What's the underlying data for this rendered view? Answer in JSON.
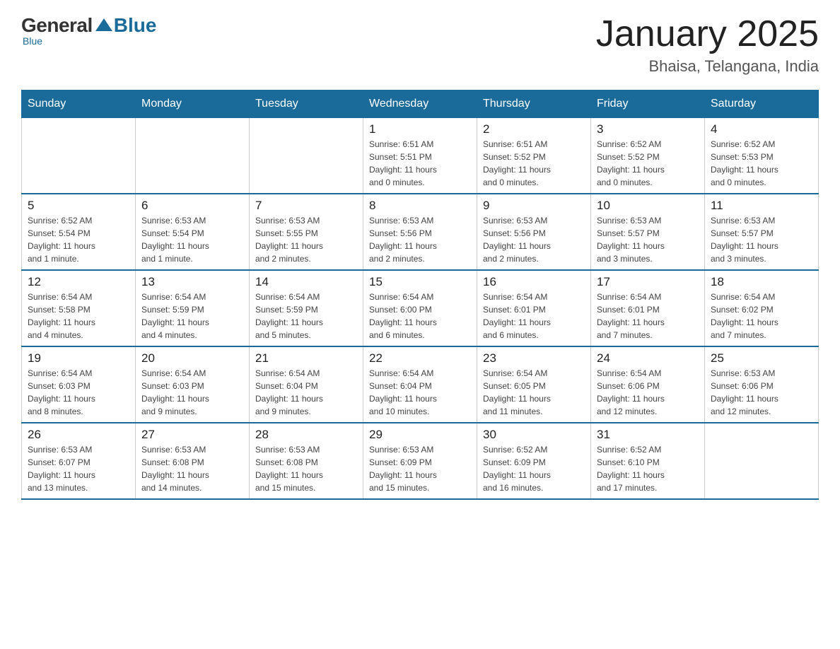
{
  "header": {
    "logo": {
      "general": "General",
      "blue": "Blue"
    },
    "title": "January 2025",
    "subtitle": "Bhaisa, Telangana, India"
  },
  "days_of_week": [
    "Sunday",
    "Monday",
    "Tuesday",
    "Wednesday",
    "Thursday",
    "Friday",
    "Saturday"
  ],
  "weeks": [
    [
      {
        "day": "",
        "info": ""
      },
      {
        "day": "",
        "info": ""
      },
      {
        "day": "",
        "info": ""
      },
      {
        "day": "1",
        "info": "Sunrise: 6:51 AM\nSunset: 5:51 PM\nDaylight: 11 hours\nand 0 minutes."
      },
      {
        "day": "2",
        "info": "Sunrise: 6:51 AM\nSunset: 5:52 PM\nDaylight: 11 hours\nand 0 minutes."
      },
      {
        "day": "3",
        "info": "Sunrise: 6:52 AM\nSunset: 5:52 PM\nDaylight: 11 hours\nand 0 minutes."
      },
      {
        "day": "4",
        "info": "Sunrise: 6:52 AM\nSunset: 5:53 PM\nDaylight: 11 hours\nand 0 minutes."
      }
    ],
    [
      {
        "day": "5",
        "info": "Sunrise: 6:52 AM\nSunset: 5:54 PM\nDaylight: 11 hours\nand 1 minute."
      },
      {
        "day": "6",
        "info": "Sunrise: 6:53 AM\nSunset: 5:54 PM\nDaylight: 11 hours\nand 1 minute."
      },
      {
        "day": "7",
        "info": "Sunrise: 6:53 AM\nSunset: 5:55 PM\nDaylight: 11 hours\nand 2 minutes."
      },
      {
        "day": "8",
        "info": "Sunrise: 6:53 AM\nSunset: 5:56 PM\nDaylight: 11 hours\nand 2 minutes."
      },
      {
        "day": "9",
        "info": "Sunrise: 6:53 AM\nSunset: 5:56 PM\nDaylight: 11 hours\nand 2 minutes."
      },
      {
        "day": "10",
        "info": "Sunrise: 6:53 AM\nSunset: 5:57 PM\nDaylight: 11 hours\nand 3 minutes."
      },
      {
        "day": "11",
        "info": "Sunrise: 6:53 AM\nSunset: 5:57 PM\nDaylight: 11 hours\nand 3 minutes."
      }
    ],
    [
      {
        "day": "12",
        "info": "Sunrise: 6:54 AM\nSunset: 5:58 PM\nDaylight: 11 hours\nand 4 minutes."
      },
      {
        "day": "13",
        "info": "Sunrise: 6:54 AM\nSunset: 5:59 PM\nDaylight: 11 hours\nand 4 minutes."
      },
      {
        "day": "14",
        "info": "Sunrise: 6:54 AM\nSunset: 5:59 PM\nDaylight: 11 hours\nand 5 minutes."
      },
      {
        "day": "15",
        "info": "Sunrise: 6:54 AM\nSunset: 6:00 PM\nDaylight: 11 hours\nand 6 minutes."
      },
      {
        "day": "16",
        "info": "Sunrise: 6:54 AM\nSunset: 6:01 PM\nDaylight: 11 hours\nand 6 minutes."
      },
      {
        "day": "17",
        "info": "Sunrise: 6:54 AM\nSunset: 6:01 PM\nDaylight: 11 hours\nand 7 minutes."
      },
      {
        "day": "18",
        "info": "Sunrise: 6:54 AM\nSunset: 6:02 PM\nDaylight: 11 hours\nand 7 minutes."
      }
    ],
    [
      {
        "day": "19",
        "info": "Sunrise: 6:54 AM\nSunset: 6:03 PM\nDaylight: 11 hours\nand 8 minutes."
      },
      {
        "day": "20",
        "info": "Sunrise: 6:54 AM\nSunset: 6:03 PM\nDaylight: 11 hours\nand 9 minutes."
      },
      {
        "day": "21",
        "info": "Sunrise: 6:54 AM\nSunset: 6:04 PM\nDaylight: 11 hours\nand 9 minutes."
      },
      {
        "day": "22",
        "info": "Sunrise: 6:54 AM\nSunset: 6:04 PM\nDaylight: 11 hours\nand 10 minutes."
      },
      {
        "day": "23",
        "info": "Sunrise: 6:54 AM\nSunset: 6:05 PM\nDaylight: 11 hours\nand 11 minutes."
      },
      {
        "day": "24",
        "info": "Sunrise: 6:54 AM\nSunset: 6:06 PM\nDaylight: 11 hours\nand 12 minutes."
      },
      {
        "day": "25",
        "info": "Sunrise: 6:53 AM\nSunset: 6:06 PM\nDaylight: 11 hours\nand 12 minutes."
      }
    ],
    [
      {
        "day": "26",
        "info": "Sunrise: 6:53 AM\nSunset: 6:07 PM\nDaylight: 11 hours\nand 13 minutes."
      },
      {
        "day": "27",
        "info": "Sunrise: 6:53 AM\nSunset: 6:08 PM\nDaylight: 11 hours\nand 14 minutes."
      },
      {
        "day": "28",
        "info": "Sunrise: 6:53 AM\nSunset: 6:08 PM\nDaylight: 11 hours\nand 15 minutes."
      },
      {
        "day": "29",
        "info": "Sunrise: 6:53 AM\nSunset: 6:09 PM\nDaylight: 11 hours\nand 15 minutes."
      },
      {
        "day": "30",
        "info": "Sunrise: 6:52 AM\nSunset: 6:09 PM\nDaylight: 11 hours\nand 16 minutes."
      },
      {
        "day": "31",
        "info": "Sunrise: 6:52 AM\nSunset: 6:10 PM\nDaylight: 11 hours\nand 17 minutes."
      },
      {
        "day": "",
        "info": ""
      }
    ]
  ]
}
